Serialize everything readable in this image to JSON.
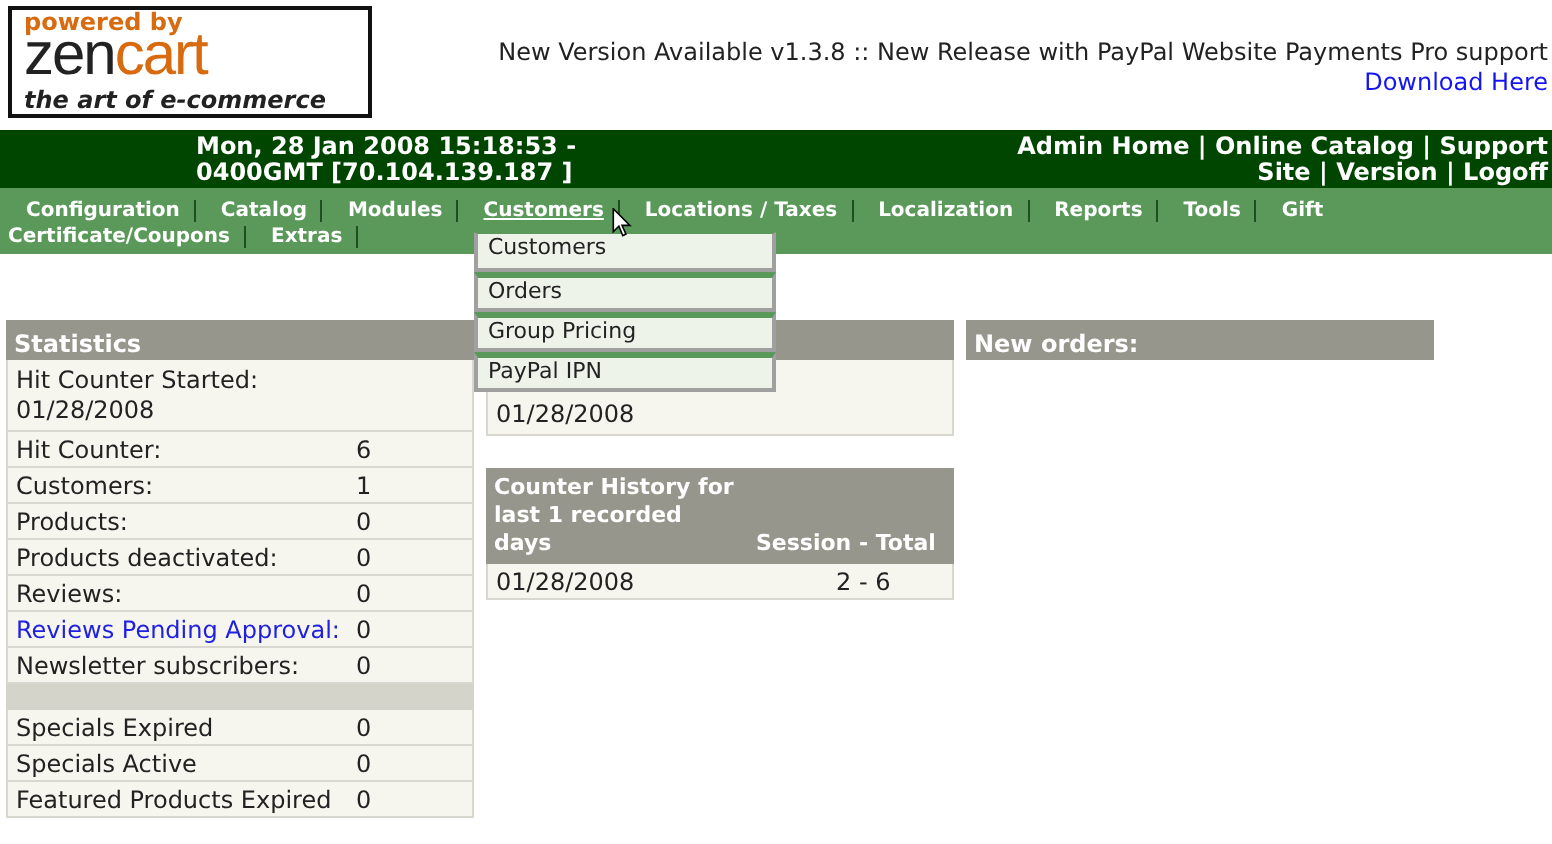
{
  "logo": {
    "powered_by": "powered by",
    "brand_left": "zen",
    "brand_right": "cart",
    "tagline": "the art of e-commerce"
  },
  "version_notice": "New Version Available v1.3.8 :: New Release with PayPal Website Payments Pro support",
  "download_link": "Download Here",
  "header": {
    "datetime_lines": [
      "Mon, 28 Jan 2008 15:18:53 -",
      "0400GMT [70.104.139.187 ]"
    ],
    "separator": "|",
    "link_rows": [
      [
        "Admin Home",
        "Online Catalog",
        "Support"
      ],
      [
        "Site",
        "Version",
        "Logoff"
      ]
    ]
  },
  "menu": [
    {
      "label": "Configuration",
      "selected": false
    },
    {
      "label": "Catalog",
      "selected": false
    },
    {
      "label": "Modules",
      "selected": false
    },
    {
      "label": "Customers",
      "selected": true
    },
    {
      "label": "Locations / Taxes",
      "selected": false
    },
    {
      "label": "Localization",
      "selected": false
    },
    {
      "label": "Reports",
      "selected": false
    },
    {
      "label": "Tools",
      "selected": false
    },
    {
      "label": "Gift Certificate/Coupons",
      "selected": false
    },
    {
      "label": "Extras",
      "selected": false
    }
  ],
  "dropdown": [
    "Customers",
    "Orders",
    "Group Pricing",
    "PayPal IPN"
  ],
  "statistics": {
    "title": "Statistics",
    "groups": [
      [
        {
          "label": "Hit Counter Started:",
          "value": "01/28/2008",
          "kind": "stacked"
        },
        {
          "label": "Hit Counter:",
          "value": "6",
          "kind": "stat"
        },
        {
          "label": "Customers:",
          "value": "1",
          "kind": "stat"
        },
        {
          "label": "Products:",
          "value": "0",
          "kind": "stat"
        },
        {
          "label": "Products deactivated:",
          "value": "0",
          "kind": "stat"
        },
        {
          "label": "Reviews:",
          "value": "0",
          "kind": "stat"
        },
        {
          "label": "Reviews Pending Approval:",
          "value": "0",
          "kind": "link"
        },
        {
          "label": "Newsletter subscribers:",
          "value": "0",
          "kind": "stat"
        }
      ],
      [
        {
          "label": "Specials Expired",
          "value": "0",
          "kind": "stat"
        },
        {
          "label": "Specials Active",
          "value": "0",
          "kind": "stat"
        },
        {
          "label": "Featured Products Expired",
          "value": "0",
          "kind": "stat"
        }
      ]
    ]
  },
  "hit_panel": {
    "date": "01/28/2008"
  },
  "counter_history": {
    "title": "Counter History for last 1 recorded days",
    "column": "Session - Total",
    "rows": [
      {
        "date": "01/28/2008",
        "value": "2 - 6"
      }
    ]
  },
  "new_orders": {
    "title": "New orders:"
  }
}
